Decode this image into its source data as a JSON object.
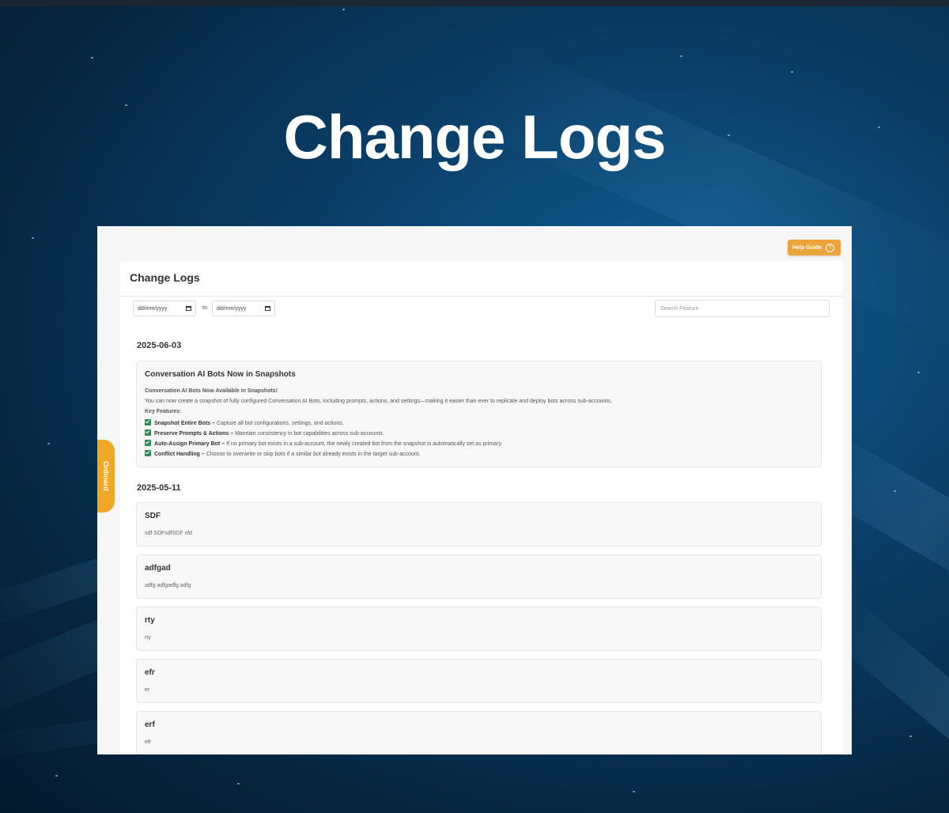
{
  "hero": {
    "title": "Change Logs"
  },
  "toolbar": {
    "help_label": "Help Guide",
    "help_icon": "question-circle-icon"
  },
  "panel": {
    "title": "Change Logs",
    "filters": {
      "date_from": "dd/mm/yyyy",
      "to_label": "to",
      "date_to": "dd/mm/yyyy",
      "search_placeholder": "Search Feature"
    }
  },
  "groups": [
    {
      "date": "2025-06-03",
      "entries": [
        {
          "title": "Conversation AI Bots Now in Snapshots",
          "heading": "Conversation AI Bots Now Available in Snapshots!",
          "intro": "You can now create a snapshot of fully configured Conversation AI Bots, including prompts, actions, and settings—making it easier than ever to replicate and deploy bots across sub-accounts.",
          "key_label": "Key Features:",
          "features": [
            {
              "name": "Snapshot Entire Bots –",
              "text": "Capture all bot configurations, settings, and actions."
            },
            {
              "name": "Preserve Prompts & Actions –",
              "text": "Maintain consistency in bot capabilities across sub-accounts."
            },
            {
              "name": "Auto-Assign Primary Bot –",
              "text": "If no primary bot exists in a sub-account, the newly created bot from the snapshot is automatically set as primary."
            },
            {
              "name": "Conflict Handling –",
              "text": "Choose to overwrite or skip bots if a similar bot already exists in the target sub-account."
            }
          ]
        }
      ]
    },
    {
      "date": "2025-05-11",
      "entries": [
        {
          "title": "SDF",
          "desc": "sdf SDFsdfSDF sfd"
        },
        {
          "title": "adfgad",
          "desc": "adfg adfgadfg adfg"
        },
        {
          "title": "rty",
          "desc": "rty"
        },
        {
          "title": "efr",
          "desc": "er"
        },
        {
          "title": "erf",
          "desc": "efr"
        }
      ]
    }
  ],
  "onboard": {
    "label": "Onboard"
  },
  "colors": {
    "accent": "#eca53a",
    "check": "#2e8b57",
    "background": "#0a3d66"
  }
}
